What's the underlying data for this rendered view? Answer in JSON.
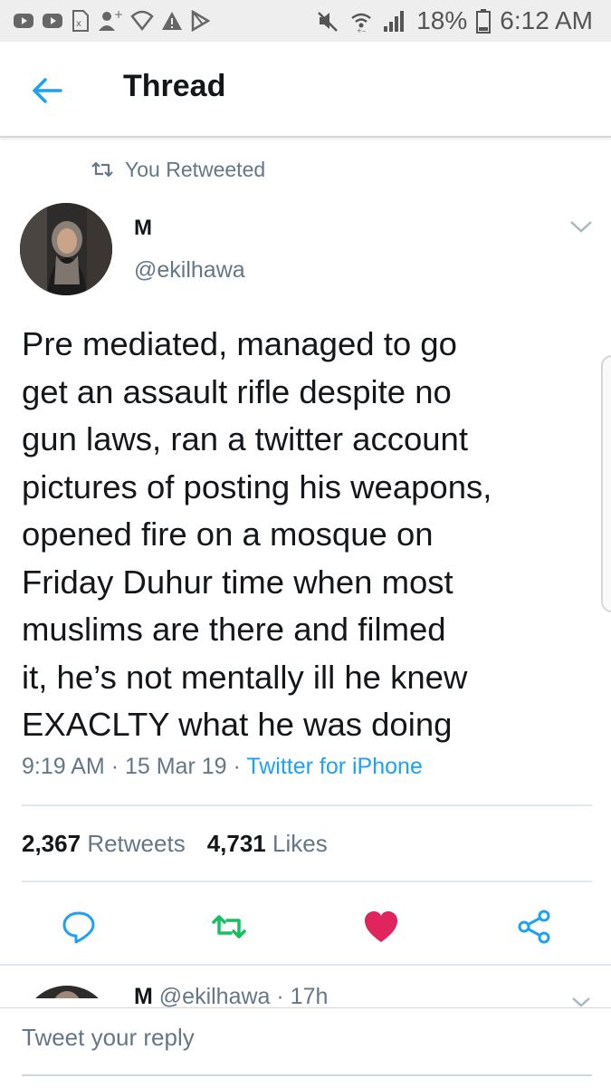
{
  "status_bar": {
    "battery": "18%",
    "time": "6:12 AM",
    "icons": [
      "youtube-icon",
      "youtube-icon",
      "sim-card-icon",
      "add-person-icon",
      "vpn-shield-icon",
      "warning-icon",
      "playstore-icon",
      "mute-icon",
      "wifi-icon",
      "signal-icon",
      "battery-icon"
    ]
  },
  "header": {
    "title": "Thread"
  },
  "tweet": {
    "context": "You Retweeted",
    "author_name": "M",
    "author_handle": "@ekilhawa",
    "text": "Pre mediated, managed to go\nget an assault rifle despite no\ngun laws, ran a twitter account\npictures of posting his weapons,\nopened fire on a mosque on\nFriday Duhur time when most\nmuslims are there and filmed\nit, he’s not mentally ill he knew\nEXACLTY what he was doing",
    "time": "9:19 AM",
    "date": "15 Mar 19",
    "source": "Twitter for iPhone",
    "retweets_count": "2,367",
    "retweets_label": "Retweets",
    "likes_count": "4,731",
    "likes_label": "Likes"
  },
  "next_tweet": {
    "author_name": "M",
    "author_handle": "@ekilhawa",
    "age": "17h"
  },
  "reply": {
    "placeholder": "Tweet your reply"
  },
  "colors": {
    "link": "#1da1f2",
    "retweet_green": "#17bf63",
    "like_red": "#e0245e",
    "secondary": "#657786"
  }
}
